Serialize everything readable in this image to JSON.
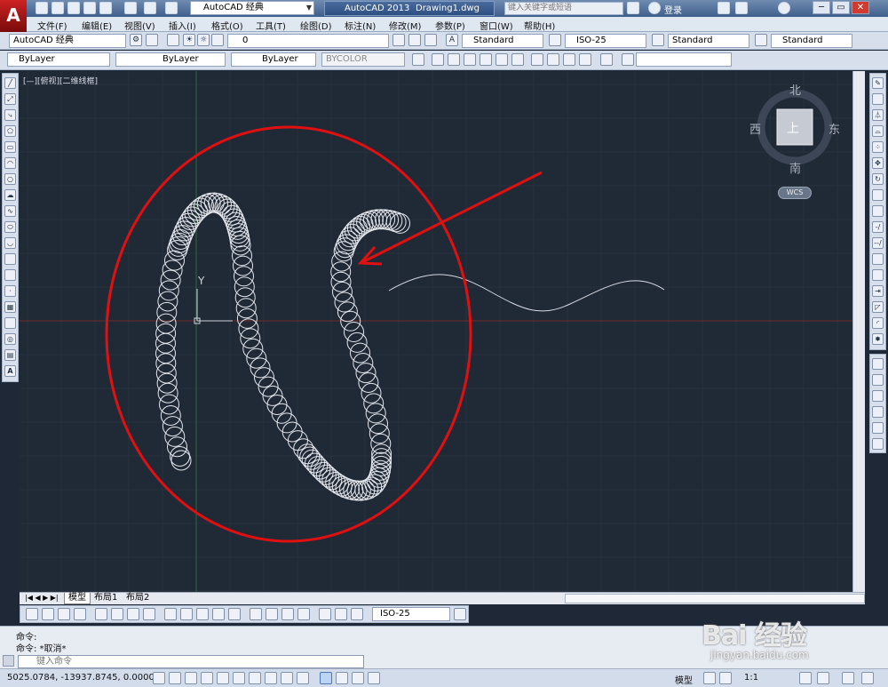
{
  "title_bar": {
    "app_logo": "A",
    "workspace": "AutoCAD 经典",
    "app_title": "AutoCAD 2013",
    "document": "Drawing1.dwg",
    "search_placeholder": "键入关键字或短语",
    "login": "登录",
    "window_buttons": [
      "─",
      "▭",
      "✕"
    ]
  },
  "menu": [
    "文件(F)",
    "编辑(E)",
    "视图(V)",
    "插入(I)",
    "格式(O)",
    "工具(T)",
    "绘图(D)",
    "标注(N)",
    "修改(M)",
    "参数(P)",
    "窗口(W)",
    "帮助(H)"
  ],
  "toolbar1": {
    "workspace": "AutoCAD 经典",
    "layer": "0",
    "text_style": "Standard",
    "dim_style": "ISO-25",
    "table_style": "Standard",
    "multileader_style": "Standard"
  },
  "toolbar2": {
    "color": "ByLayer",
    "linetype": "ByLayer",
    "lineweight": "ByLayer",
    "plot_style": "BYCOLOR"
  },
  "viewport": {
    "label": "[—][俯视][二维线框]",
    "ucs_y": "Y",
    "compass": {
      "north": "北",
      "south": "南",
      "east": "东",
      "west": "西",
      "top": "上"
    },
    "wcs": "WCS"
  },
  "tabs": [
    "模型",
    "布局1",
    "布局2"
  ],
  "dim_toolbar": {
    "dim_style": "ISO-25"
  },
  "command": {
    "history": [
      "命令:",
      "命令: *取消*"
    ],
    "placeholder": "键入命令"
  },
  "status": {
    "coords": "5025.0784,  -13937.8745, 0.0000",
    "model": "模型",
    "scale": "1:1"
  },
  "watermark": {
    "main": "Bai 经验",
    "sub": "jingyan.baidu.com"
  },
  "colors": {
    "annotation_red": "#e01010",
    "background": "#202936",
    "grid": "#2a3443"
  }
}
